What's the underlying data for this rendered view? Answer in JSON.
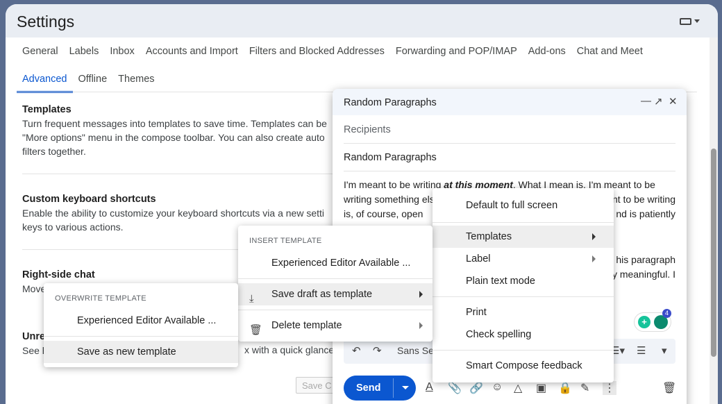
{
  "header": {
    "title": "Settings"
  },
  "tabs_row1": [
    "General",
    "Labels",
    "Inbox",
    "Accounts and Import",
    "Filters and Blocked Addresses",
    "Forwarding and POP/IMAP",
    "Add-ons",
    "Chat and Meet"
  ],
  "tabs_row2": [
    "Advanced",
    "Offline",
    "Themes"
  ],
  "sections": [
    {
      "title": "Templates",
      "lines": [
        "Turn frequent messages into templates to save time. Templates can be",
        "\"More options\" menu in the compose toolbar. You can also create auto",
        "filters together."
      ]
    },
    {
      "title": "Custom keyboard shortcuts",
      "lines": [
        "Enable the ability to customize your keyboard shortcuts via a new setti",
        "keys to various actions."
      ]
    },
    {
      "title": "Right-side chat",
      "lines": [
        "Move"
      ]
    },
    {
      "title": "Unre",
      "lines": [
        "See h",
        "x with a quick glance"
      ]
    }
  ],
  "save_button": "Save C",
  "compose": {
    "title": "Random Paragraphs",
    "recipients_placeholder": "Recipients",
    "subject": "Random Paragraphs",
    "body": {
      "l1_a": "I'm meant to be writing ",
      "l1_em": "at this moment",
      "l1_b": ". What I mean is, I'm meant to be",
      "l2_a": "writing something els",
      "l2_b": "nt to be writing",
      "l3_a": "is, of course, open",
      "l3_b": "nd is patiently",
      "l4": "his paragraph",
      "l5": "y meaningful. I"
    },
    "font": "Sans Se",
    "send_label": "Send"
  },
  "context_menu": {
    "items": [
      "Default to full screen",
      "Templates",
      "Label",
      "Plain text mode",
      "Print",
      "Check spelling",
      "Smart Compose feedback"
    ]
  },
  "templates_menu": {
    "header": "INSERT TEMPLATE",
    "insert_item": "Experienced Editor Available ...",
    "save_draft": "Save draft as template",
    "delete": "Delete template"
  },
  "overwrite_menu": {
    "header": "OVERWRITE TEMPLATE",
    "item": "Experienced Editor Available ...",
    "save_new": "Save as new template"
  },
  "grammarly_badge": "4"
}
